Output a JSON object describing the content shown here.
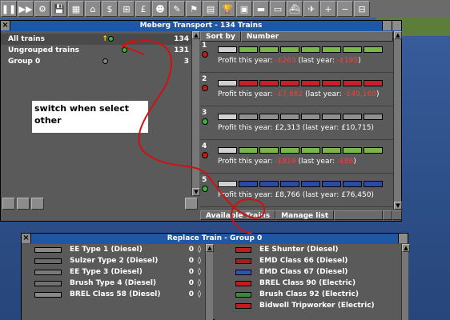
{
  "toolbar": {
    "icons": [
      "pause-icon",
      "fast-forward-icon",
      "settings-icon",
      "save-icon",
      "map-icon",
      "town-icon",
      "subsidies-icon",
      "stations-icon",
      "finances-icon",
      "company-icon",
      "story-icon",
      "goals-icon",
      "graphs-icon",
      "league-icon",
      "industries-icon",
      "trains-icon",
      "road-vehicles-icon",
      "ships-icon",
      "aircraft-icon",
      "zoom-in-icon",
      "zoom-out-icon",
      "build-rail-icon"
    ]
  },
  "train_window": {
    "title": "Meberg Transport - 134 Trains",
    "groups": [
      {
        "label": "All trains",
        "count": "134"
      },
      {
        "label": "Ungrouped trains",
        "count": "131"
      },
      {
        "label": "Group 0",
        "count": "3"
      }
    ],
    "sort_label": "Sort by",
    "sort_value": "Number",
    "trains": [
      {
        "num": "1",
        "status": "#c41c1c",
        "profit_prefix": "Profit this year:",
        "profit": "-£263",
        "last_prefix": "(last year:",
        "last": "-£195",
        "last_suffix": ")",
        "negative": true,
        "livery": "#7ab64a"
      },
      {
        "num": "2",
        "status": "#c41c1c",
        "profit_prefix": "Profit this year:",
        "profit": "-£7,882",
        "last_prefix": "(last year:",
        "last": "-£49,160",
        "last_suffix": ")",
        "negative": true,
        "livery": "#c8202a"
      },
      {
        "num": "3",
        "status": "#3ab43a",
        "profit_prefix": "Profit this year: £2,313 (last year: £10,715)",
        "profit": "",
        "last_prefix": "",
        "last": "",
        "last_suffix": "",
        "negative": false,
        "livery": "#909090"
      },
      {
        "num": "4",
        "status": "#c41c1c",
        "profit_prefix": "Profit this year:",
        "profit": "-£819",
        "last_prefix": "(last year:",
        "last": "-£86",
        "last_suffix": ")",
        "negative": true,
        "livery": "#7ab64a"
      },
      {
        "num": "5",
        "status": "#3ab43a",
        "profit_prefix": "Profit this year: £8,766 (last year: £76,450)",
        "profit": "",
        "last_prefix": "",
        "last": "",
        "last_suffix": "",
        "negative": false,
        "livery": "#2a4aa8"
      }
    ],
    "available_trains_label": "Available Trains",
    "manage_list_label": "Manage list"
  },
  "annotation": {
    "note_text": "switch when select other"
  },
  "replace_window": {
    "title": "Replace Train - Group 0",
    "left_items": [
      {
        "label": "EE Type 1 (Diesel)",
        "count": "0",
        "color": "#888888"
      },
      {
        "label": "Sulzer Type 2 (Diesel)",
        "count": "0",
        "color": "#6a6a6a"
      },
      {
        "label": "EE Type 3 (Diesel)",
        "count": "0",
        "color": "#7a7a7a"
      },
      {
        "label": "Brush Type 4 (Diesel)",
        "count": "0",
        "color": "#707070"
      },
      {
        "label": "BREL Class 58 (Diesel)",
        "count": "0",
        "color": "#8a8a8a"
      }
    ],
    "right_items": [
      {
        "label": "EE Shunter (Diesel)",
        "color": "#c41c1c"
      },
      {
        "label": "EMD Class 66 (Diesel)",
        "color": "#a02020"
      },
      {
        "label": "EMD Class 67 (Diesel)",
        "color": "#2a56b4"
      },
      {
        "label": "BREL Class 90 (Electric)",
        "color": "#c41c1c"
      },
      {
        "label": "Brush Class 92 (Electric)",
        "color": "#3a8a3a"
      },
      {
        "label": "Bidwell Tripworker (Electric)",
        "color": "#c41c1c"
      }
    ]
  }
}
